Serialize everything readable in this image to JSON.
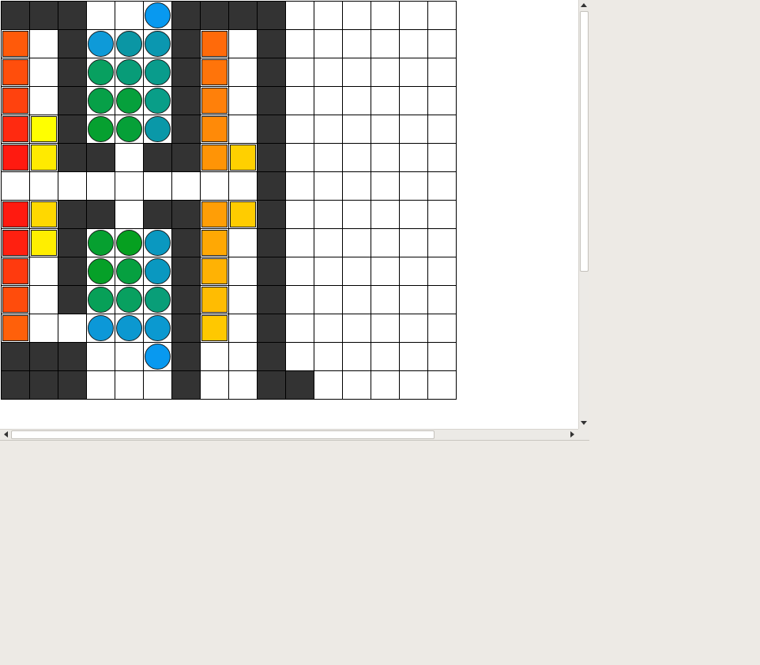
{
  "board": {
    "rows": 14,
    "cols": 16,
    "walls": [
      [
        0,
        0
      ],
      [
        0,
        1
      ],
      [
        0,
        2
      ],
      [
        0,
        6
      ],
      [
        0,
        7
      ],
      [
        0,
        8
      ],
      [
        0,
        9
      ],
      [
        1,
        2
      ],
      [
        1,
        6
      ],
      [
        1,
        9
      ],
      [
        2,
        2
      ],
      [
        2,
        6
      ],
      [
        2,
        9
      ],
      [
        3,
        2
      ],
      [
        3,
        6
      ],
      [
        3,
        9
      ],
      [
        4,
        2
      ],
      [
        4,
        6
      ],
      [
        4,
        9
      ],
      [
        5,
        2
      ],
      [
        5,
        3
      ],
      [
        5,
        5
      ],
      [
        5,
        6
      ],
      [
        5,
        9
      ],
      [
        6,
        9
      ],
      [
        7,
        2
      ],
      [
        7,
        3
      ],
      [
        7,
        5
      ],
      [
        7,
        6
      ],
      [
        7,
        9
      ],
      [
        8,
        2
      ],
      [
        8,
        6
      ],
      [
        8,
        9
      ],
      [
        9,
        2
      ],
      [
        9,
        6
      ],
      [
        9,
        9
      ],
      [
        10,
        2
      ],
      [
        10,
        6
      ],
      [
        10,
        9
      ],
      [
        11,
        6
      ],
      [
        11,
        9
      ],
      [
        12,
        0
      ],
      [
        12,
        1
      ],
      [
        12,
        2
      ],
      [
        12,
        6
      ],
      [
        12,
        9
      ],
      [
        13,
        0
      ],
      [
        13,
        1
      ],
      [
        13,
        2
      ],
      [
        13,
        6
      ],
      [
        13,
        9
      ],
      [
        13,
        10
      ]
    ],
    "squares": [
      {
        "r": 1,
        "c": 0,
        "color": "#ff5a0a"
      },
      {
        "r": 2,
        "c": 0,
        "color": "#ff4e0c"
      },
      {
        "r": 3,
        "c": 0,
        "color": "#ff420e"
      },
      {
        "r": 4,
        "c": 0,
        "color": "#ff2a10"
      },
      {
        "r": 4,
        "c": 1,
        "color": "#ffff00"
      },
      {
        "r": 5,
        "c": 0,
        "color": "#ff1a10"
      },
      {
        "r": 5,
        "c": 1,
        "color": "#ffea00"
      },
      {
        "r": 7,
        "c": 0,
        "color": "#ff1a10"
      },
      {
        "r": 7,
        "c": 1,
        "color": "#ffd800"
      },
      {
        "r": 8,
        "c": 0,
        "color": "#ff2010"
      },
      {
        "r": 8,
        "c": 1,
        "color": "#ffee00"
      },
      {
        "r": 9,
        "c": 0,
        "color": "#ff3a0e"
      },
      {
        "r": 10,
        "c": 0,
        "color": "#ff4c0c"
      },
      {
        "r": 11,
        "c": 0,
        "color": "#ff600a"
      },
      {
        "r": 1,
        "c": 7,
        "color": "#ff6a0a"
      },
      {
        "r": 2,
        "c": 7,
        "color": "#ff740a"
      },
      {
        "r": 3,
        "c": 7,
        "color": "#ff800a"
      },
      {
        "r": 4,
        "c": 7,
        "color": "#ff8a08"
      },
      {
        "r": 5,
        "c": 7,
        "color": "#ff9406"
      },
      {
        "r": 5,
        "c": 8,
        "color": "#ffd000"
      },
      {
        "r": 7,
        "c": 7,
        "color": "#ff9e06"
      },
      {
        "r": 7,
        "c": 8,
        "color": "#ffcc00"
      },
      {
        "r": 8,
        "c": 7,
        "color": "#ffa804"
      },
      {
        "r": 9,
        "c": 7,
        "color": "#ffb204"
      },
      {
        "r": 10,
        "c": 7,
        "color": "#ffbc02"
      },
      {
        "r": 11,
        "c": 7,
        "color": "#ffc800"
      }
    ],
    "balls": [
      {
        "r": 0,
        "c": 5,
        "color": "#0899f0"
      },
      {
        "r": 1,
        "c": 3,
        "color": "#0e9ad8"
      },
      {
        "r": 1,
        "c": 4,
        "color": "#0b96a4"
      },
      {
        "r": 1,
        "c": 5,
        "color": "#0b97b0"
      },
      {
        "r": 2,
        "c": 3,
        "color": "#08a060"
      },
      {
        "r": 2,
        "c": 4,
        "color": "#089c78"
      },
      {
        "r": 2,
        "c": 5,
        "color": "#099c8c"
      },
      {
        "r": 3,
        "c": 3,
        "color": "#07a048"
      },
      {
        "r": 3,
        "c": 4,
        "color": "#06a03c"
      },
      {
        "r": 3,
        "c": 5,
        "color": "#099e88"
      },
      {
        "r": 4,
        "c": 3,
        "color": "#06a030"
      },
      {
        "r": 4,
        "c": 4,
        "color": "#06a038"
      },
      {
        "r": 4,
        "c": 5,
        "color": "#0a98a8"
      },
      {
        "r": 8,
        "c": 3,
        "color": "#06a030"
      },
      {
        "r": 8,
        "c": 4,
        "color": "#06a020"
      },
      {
        "r": 8,
        "c": 5,
        "color": "#0a98c0"
      },
      {
        "r": 9,
        "c": 3,
        "color": "#06a028"
      },
      {
        "r": 9,
        "c": 4,
        "color": "#06a040"
      },
      {
        "r": 9,
        "c": 5,
        "color": "#0a98c0"
      },
      {
        "r": 10,
        "c": 3,
        "color": "#07a058"
      },
      {
        "r": 10,
        "c": 4,
        "color": "#08a060"
      },
      {
        "r": 10,
        "c": 5,
        "color": "#099e78"
      },
      {
        "r": 11,
        "c": 3,
        "color": "#0c98d8"
      },
      {
        "r": 11,
        "c": 4,
        "color": "#0c98d0"
      },
      {
        "r": 11,
        "c": 5,
        "color": "#0b99d0"
      },
      {
        "r": 12,
        "c": 5,
        "color": "#0899f0"
      }
    ]
  },
  "scroll": {
    "vertical_thumb_fraction": 0.62,
    "horizontal_thumb_fraction": 0.76
  }
}
